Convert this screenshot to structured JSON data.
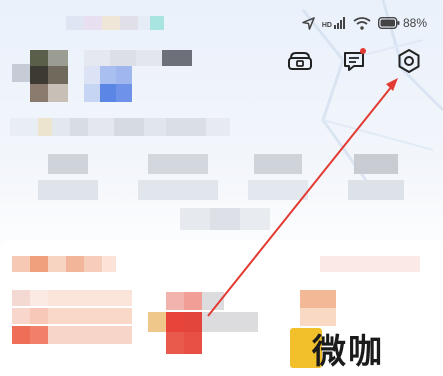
{
  "status_bar": {
    "battery_text": "88%",
    "network_label": "HD"
  },
  "header_icons": [
    {
      "name": "wallet-icon"
    },
    {
      "name": "message-icon",
      "has_notification": true
    },
    {
      "name": "settings-icon"
    }
  ],
  "watermark": {
    "text": "微咖"
  },
  "colors": {
    "annotation_arrow": "#e23b34",
    "background_top": "#eaf1fb",
    "accent_orange": "#f07f4a",
    "accent_red": "#e8443a"
  }
}
